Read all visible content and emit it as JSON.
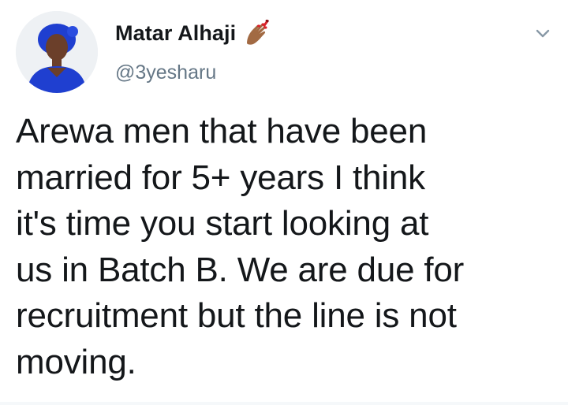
{
  "tweet": {
    "author": {
      "display_name": "Matar Alhaji",
      "handle": "@3yesharu",
      "emoji_icon": "nail-polish-icon"
    },
    "menu_icon": "chevron-down-icon",
    "text": "Arewa men that have been\nmarried for 5+ years I think\nit's time you start looking at\nus in Batch B. We are due for\nrecruitment but the line is not\nmoving."
  },
  "colors": {
    "text_primary": "#14171a",
    "text_secondary": "#657786",
    "avatar_outfit": "#1f3fd0",
    "chevron": "#8899a6"
  }
}
